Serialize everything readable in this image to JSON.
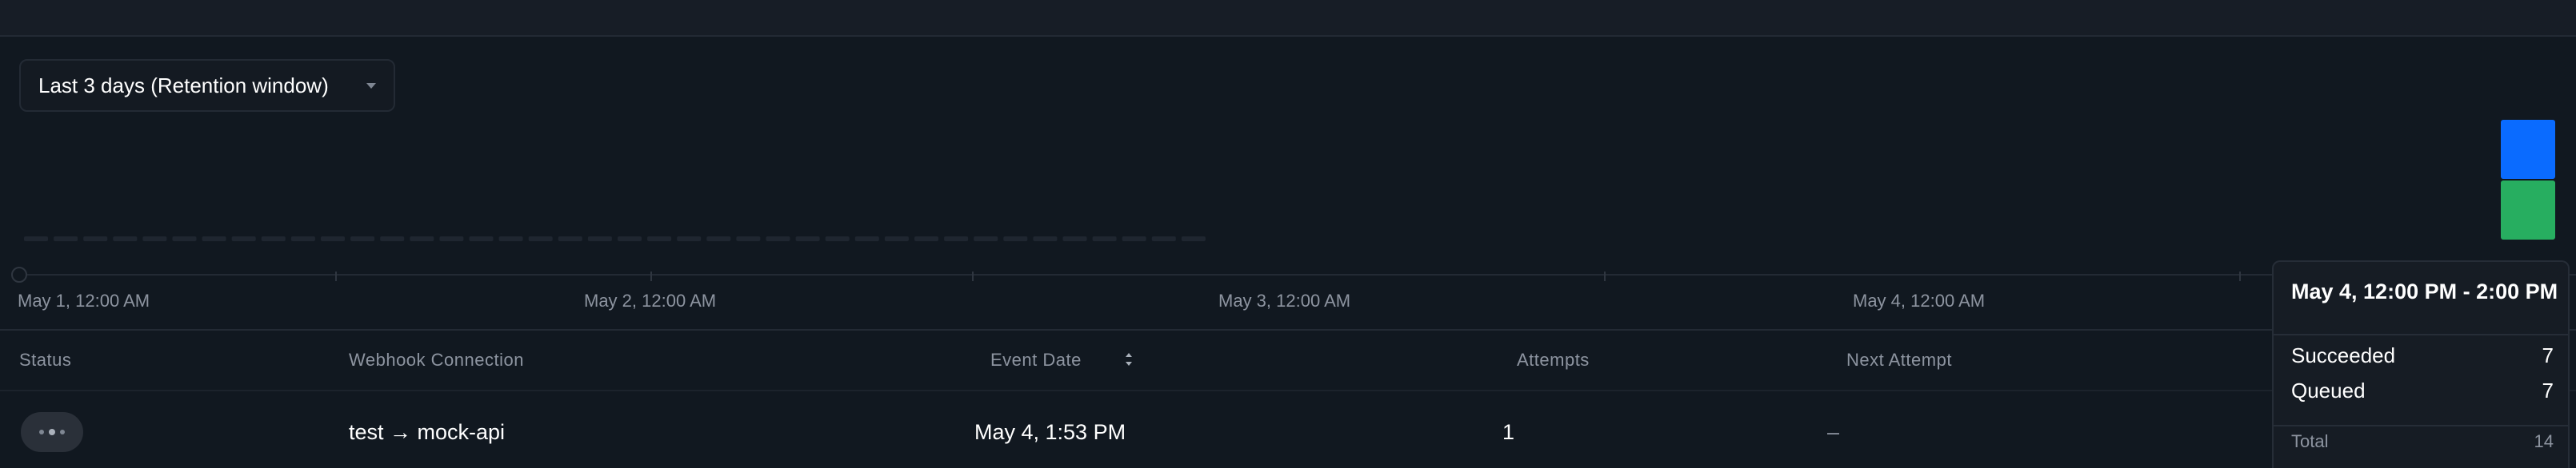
{
  "filter": {
    "label": "Last 3 days (Retention window)"
  },
  "chart_data": {
    "type": "bar",
    "stacked": true,
    "x_ticks": [
      "May 1, 12:00 AM",
      "May 2, 12:00 AM",
      "May 3, 12:00 AM",
      "May 4, 12:00 AM"
    ],
    "series": [
      {
        "name": "Succeeded",
        "color": "#27ae60"
      },
      {
        "name": "Queued",
        "color": "#0a6bff"
      }
    ],
    "bins": [
      {
        "label": "May 4, 12:00 PM - 2:00 PM",
        "succeeded": 7,
        "queued": 7
      }
    ],
    "legend": "tooltip"
  },
  "table": {
    "headers": {
      "status": "Status",
      "connection": "Webhook Connection",
      "event_date": "Event Date",
      "attempts": "Attempts",
      "next_attempt": "Next Attempt"
    },
    "rows": [
      {
        "connection": "test → mock-api",
        "event_date": "May 4, 1:53 PM",
        "attempts": "1",
        "next_attempt": "–"
      }
    ]
  },
  "tooltip": {
    "title": "May 4, 12:00 PM - 2:00 PM",
    "rows": [
      {
        "label": "Succeeded",
        "value": "7"
      },
      {
        "label": "Queued",
        "value": "7"
      }
    ],
    "total_label": "Total",
    "total_value": "14"
  }
}
